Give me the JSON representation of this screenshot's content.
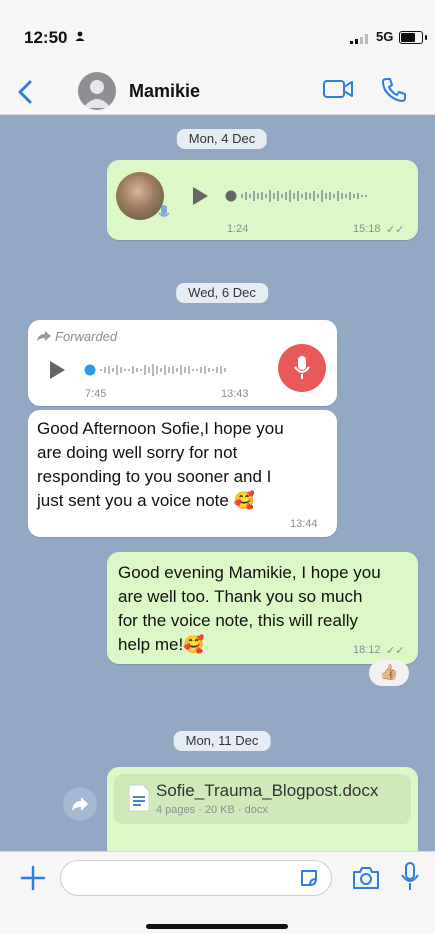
{
  "status_bar": {
    "time": "12:50",
    "network": "5G"
  },
  "header": {
    "contact_name": "Mamikie"
  },
  "dates": {
    "d1": "Mon, 4 Dec",
    "d2": "Wed, 6 Dec",
    "d3": "Mon, 11 Dec"
  },
  "messages": {
    "voice_out": {
      "duration": "1:24",
      "time": "15:18",
      "ticks": "✓✓"
    },
    "voice_in": {
      "forwarded_label": "Forwarded",
      "duration": "7:45",
      "time": "13:43"
    },
    "text_in": {
      "lines": [
        "Good Afternoon Sofie,I hope you",
        "are doing well sorry for not",
        "responding to you sooner and I",
        "just sent you a voice note 🥰"
      ],
      "time": "13:44"
    },
    "text_out": {
      "lines": [
        "Good evening Mamikie, I hope you",
        "are well too. Thank you so much",
        "for the voice note, this will really",
        "help me!🥰"
      ],
      "time": "18:12",
      "ticks": "✓✓",
      "reaction": "👍🏼"
    },
    "doc_out": {
      "file_name": "Sofie_Trauma_Blogpost.docx",
      "file_info": "4 pages · 20 KB · docx"
    }
  },
  "icons": [
    "back-icon",
    "video-call-icon",
    "phone-icon",
    "play-icon",
    "mic-icon",
    "forward-icon",
    "document-icon",
    "plus-icon",
    "sticker-icon",
    "camera-icon"
  ],
  "colors": {
    "chat_bg": "#93a8c3",
    "outgoing": "#dcf8c6",
    "incoming": "#ffffff",
    "accent": "#2f7de1",
    "mic_red": "#e85a5a"
  }
}
